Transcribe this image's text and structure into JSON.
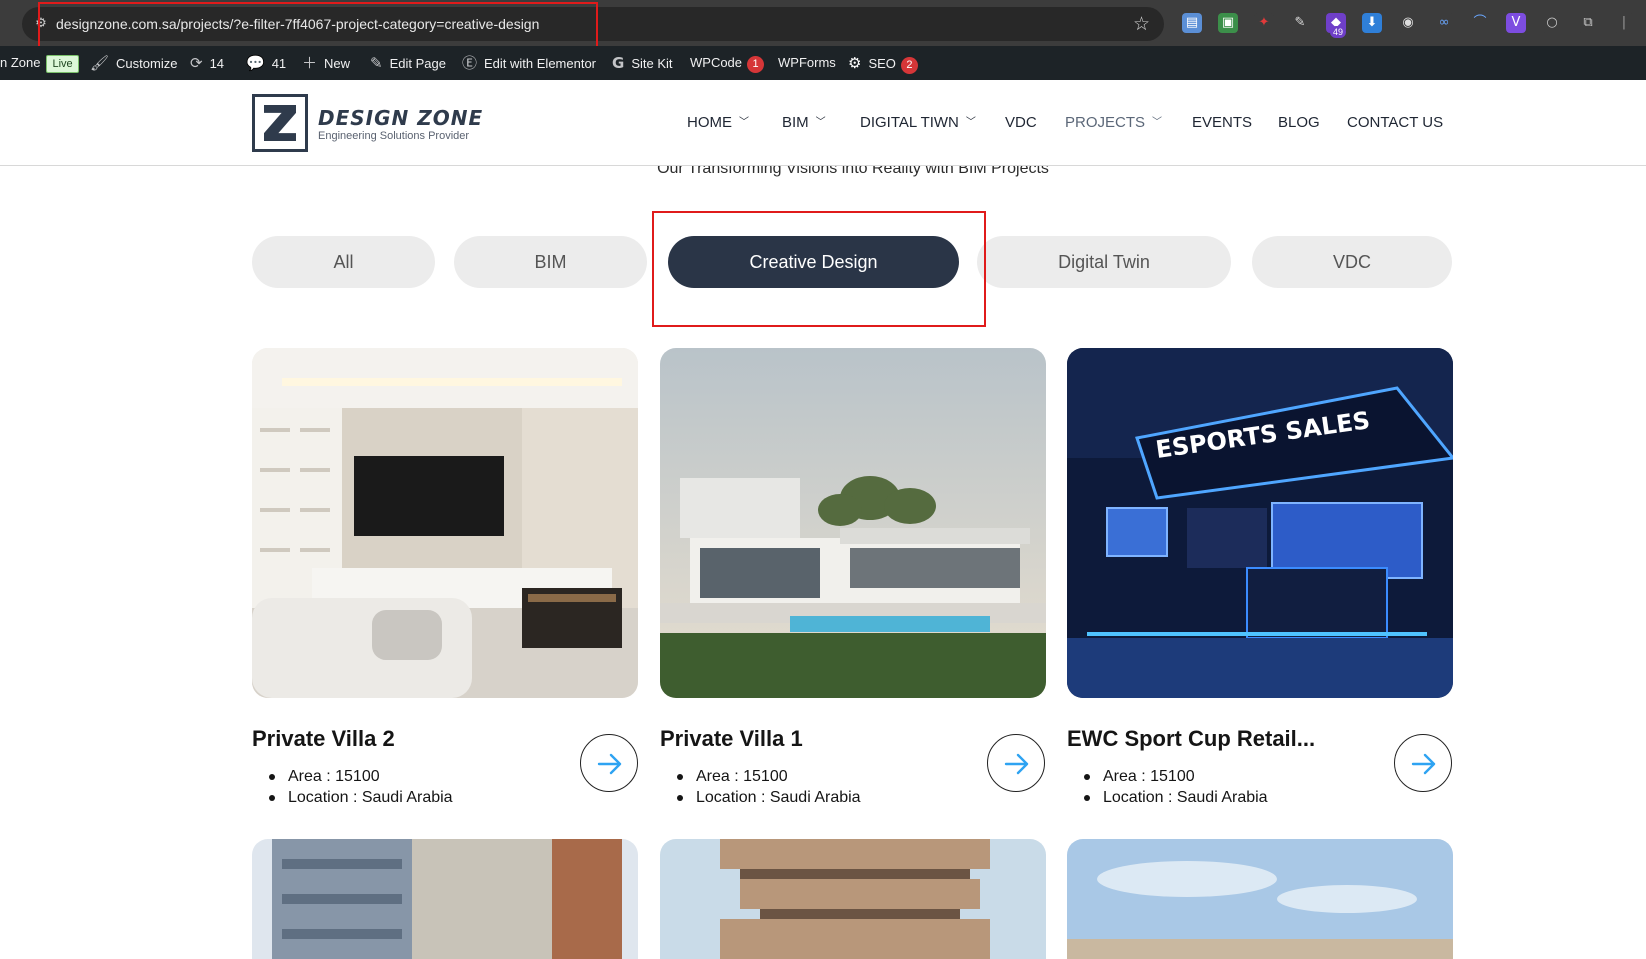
{
  "browser": {
    "url": "designzone.com.sa/projects/?e-filter-7ff4067-project-category=creative-design",
    "extension_badge": "49"
  },
  "admin_bar": {
    "site_name": "n Zone",
    "live_label": "Live",
    "customize": "Customize",
    "updates_count": "14",
    "comments_count": "41",
    "new": "New",
    "edit_page": "Edit Page",
    "edit_elementor": "Edit with Elementor",
    "site_kit": "Site Kit",
    "wpcode": "WPCode",
    "wpcode_badge": "1",
    "wpforms": "WPForms",
    "seo": "SEO",
    "seo_badge": "2"
  },
  "header": {
    "logo_title": "DESIGN ZONE",
    "logo_tagline": "Engineering Solutions Provider",
    "nav": [
      {
        "label": "HOME"
      },
      {
        "label": "BIM"
      },
      {
        "label": "DIGITAL TIWN"
      },
      {
        "label": "VDC"
      },
      {
        "label": "PROJECTS"
      },
      {
        "label": "EVENTS"
      },
      {
        "label": "BLOG"
      },
      {
        "label": "CONTACT US"
      }
    ]
  },
  "main": {
    "subtitle": "Our Transforming Visions into Reality with BIM Projects",
    "filters": [
      {
        "label": "All"
      },
      {
        "label": "BIM"
      },
      {
        "label": "Creative Design"
      },
      {
        "label": "Digital Twin"
      },
      {
        "label": "VDC"
      }
    ],
    "selected_filter": "Creative Design",
    "esports_sign": "ESPORTS SALES",
    "projects": [
      {
        "title": "Private Villa 2",
        "area": "Area : 15100",
        "location": "Location : Saudi Arabia"
      },
      {
        "title": "Private Villa 1",
        "area": "Area : 15100",
        "location": "Location : Saudi Arabia"
      },
      {
        "title": "EWC Sport Cup Retail...",
        "area": "Area : 15100",
        "location": "Location : Saudi Arabia"
      }
    ]
  },
  "colors": {
    "accent_dark": "#2a3547",
    "highlight_red": "#e01b1b",
    "arrow_blue": "#2ea3f2",
    "admin_bar": "#1d2327"
  }
}
